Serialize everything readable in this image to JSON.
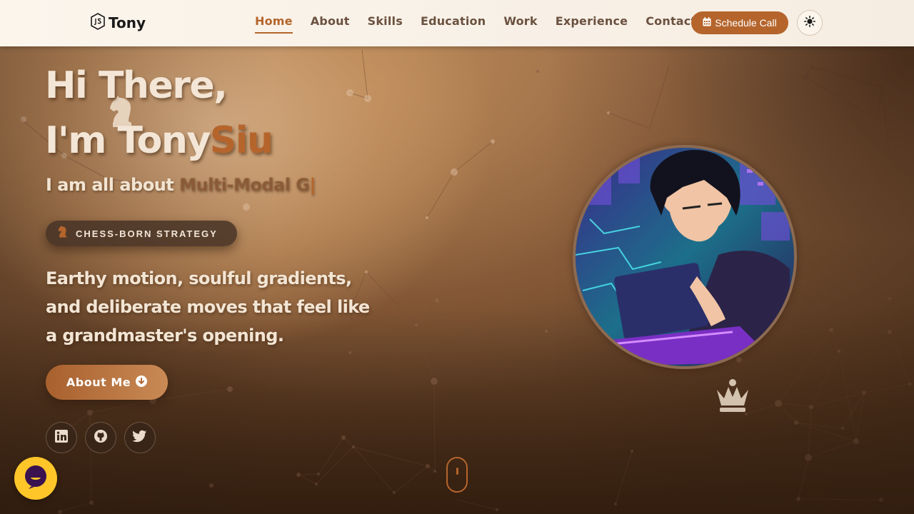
{
  "navbar": {
    "brand_name": "Tony",
    "links": [
      {
        "label": "Home",
        "active": true
      },
      {
        "label": "About",
        "active": false
      },
      {
        "label": "Skills",
        "active": false
      },
      {
        "label": "Education",
        "active": false
      },
      {
        "label": "Work",
        "active": false
      },
      {
        "label": "Experience",
        "active": false
      },
      {
        "label": "Contact",
        "active": false
      }
    ],
    "schedule_label": "Schedule Call",
    "theme_icon": "sun-icon"
  },
  "hero": {
    "greeting": "Hi There,",
    "intro_prefix": "I'm Tony",
    "intro_accent": "Siu",
    "typing_prefix": "I am all about ",
    "typing_text": "Multi-Modal G",
    "typing_cursor": "|",
    "badge_label": "CHESS-BORN STRATEGY",
    "tagline": "Earthy motion, soulful gradients, and deliberate moves that feel like a grandmaster's opening.",
    "about_button_label": "About Me",
    "socials": [
      "linkedin-icon",
      "github-icon",
      "twitter-icon"
    ]
  },
  "colors": {
    "accent": "#b5652c",
    "nav_bg": "#fbf5ec",
    "chat_bubble": "#ffc629"
  }
}
